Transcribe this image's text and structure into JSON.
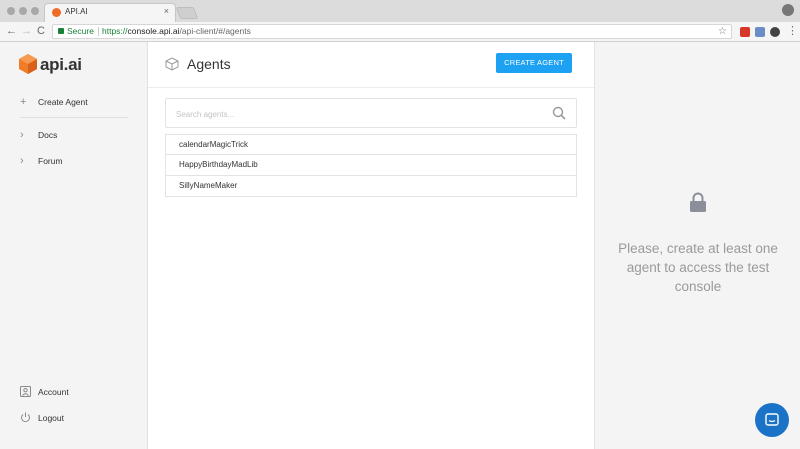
{
  "browser": {
    "tab_title": "API.AI",
    "tab_close": "×",
    "secure_label": "Secure",
    "url_scheme": "https://",
    "url_host": "console.api.ai",
    "url_path": "/api-client/#/agents",
    "back": "←",
    "forward": "→",
    "reload": "C",
    "bookmark": "☆",
    "menu": "⋮"
  },
  "logo": {
    "text": "api.ai",
    "brand_color": "#f07c28"
  },
  "sidebar": {
    "create_agent": {
      "label": "Create Agent",
      "icon": "plus-icon",
      "glyph": "+"
    },
    "items": [
      {
        "label": "Docs",
        "icon": "chevron-right-icon",
        "glyph": "›"
      },
      {
        "label": "Forum",
        "icon": "chevron-right-icon",
        "glyph": "›"
      }
    ],
    "footer": [
      {
        "label": "Account",
        "icon": "account-icon"
      },
      {
        "label": "Logout",
        "icon": "power-icon"
      }
    ]
  },
  "main": {
    "title": "Agents",
    "create_button": "CREATE AGENT",
    "search_placeholder": "Search agents...",
    "agents": [
      "calendarMagicTrick",
      "HappyBirthdayMadLib",
      "SillyNameMaker"
    ]
  },
  "console": {
    "message": "Please, create at least one agent to access the test console",
    "lock_icon": "lock-icon"
  },
  "colors": {
    "accent": "#1da1f2",
    "chat": "#1a73c6",
    "secure": "#188038"
  }
}
